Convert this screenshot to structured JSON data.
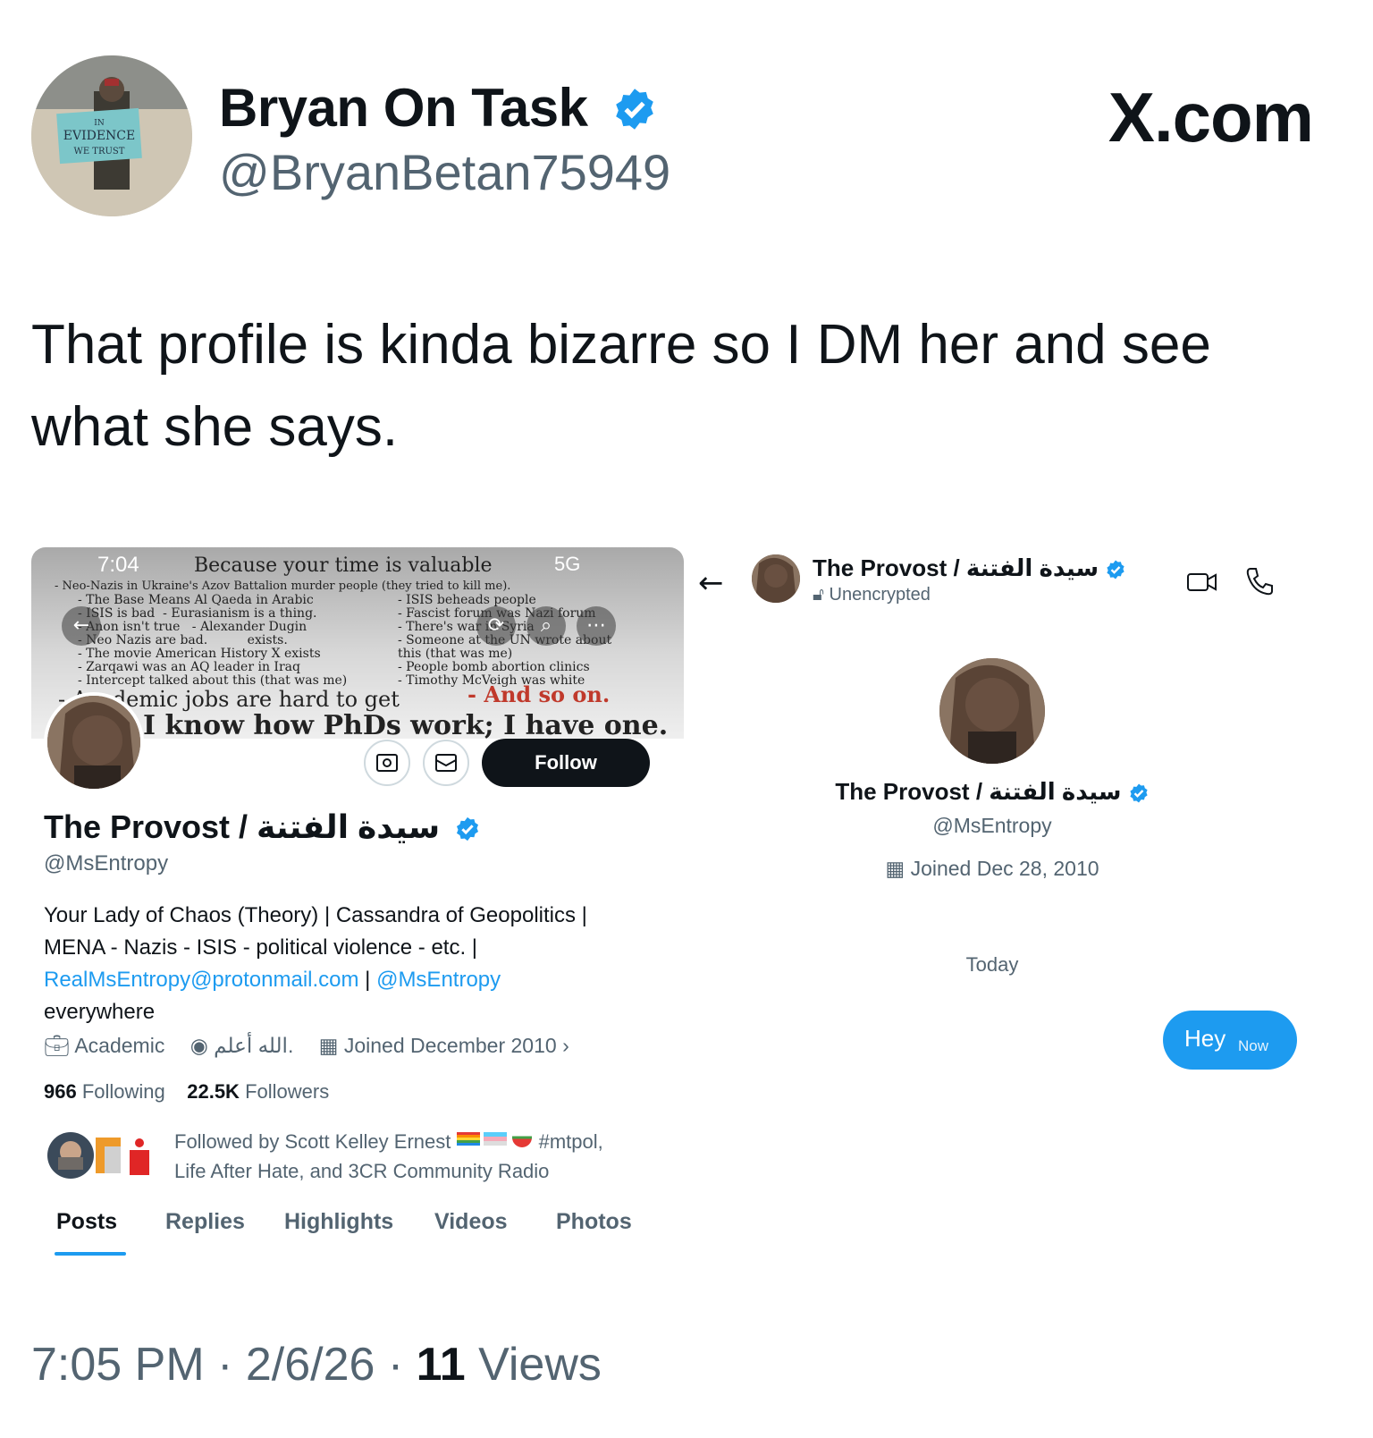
{
  "tweet": {
    "author_name": "Bryan On Task",
    "author_handle": "@BryanBetan75949",
    "brand": "X.com",
    "avatar_sign": {
      "line1": "IN",
      "line2": "EVIDENCE",
      "line3": "WE TRUST"
    },
    "text": "That profile is kinda bizarre so I DM her and see what she says.",
    "footer": {
      "time": "7:05 PM",
      "sep1": " · ",
      "date": "2/6/26",
      "sep2": " · ",
      "views_count": "11",
      "views_label": " Views"
    }
  },
  "profile_screenshot": {
    "status_time": "7:04",
    "status_network": "5G",
    "banner": {
      "line1": "Because your time is valuable",
      "line2": "- Neo-Nazis in Ukraine's Azov Battalion murder people (they tried to kill me).",
      "col1": "- The Base Means Al Qaeda in Arabic\n- ISIS is bad  - Eurasianism is a thing.\n- Anon isn't true   - Alexander Dugin\n- Neo Nazis are bad.          exists.\n- The movie American History X exists\n- Zarqawi was an AQ leader in Iraq\n- Intercept talked about this (that was me)",
      "col2": "- ISIS beheads people\n- Fascist forum was Nazi forum\n- There's war in Syria\n- Someone at the UN wrote about\nthis (that was me)\n- People bomb abortion clinics\n- Timothy McVeigh was white",
      "academic": "- Academic jobs are hard to get",
      "so_on": "- And so on.",
      "phd": "I know how PhDs work; I have one."
    },
    "follow_label": "Follow",
    "name": "The Provost / سيدة الفتنة",
    "handle": "@MsEntropy",
    "bio_line1": "Your Lady of Chaos (Theory) | Cassandra of Geopolitics |",
    "bio_line2": "MENA - Nazis - ISIS - political violence - etc. |",
    "bio_email": "RealMsEntropy@protonmail.com",
    "bio_sep": " | ",
    "bio_mention": "@MsEntropy",
    "bio_line4": "everywhere",
    "meta": {
      "category": "Academic",
      "location": "الله أعلم.",
      "joined": "Joined December 2010"
    },
    "following_count": "966",
    "following_label": "Following",
    "followers_count": "22.5K",
    "followers_label": "Followers",
    "followed_by_line1": "Followed by Scott Kelley Ernest",
    "followed_by_tag": "#mtpol,",
    "followed_by_line2": "Life After Hate, and 3CR Community Radio",
    "tabs": [
      "Posts",
      "Replies",
      "Highlights",
      "Videos",
      "Photos"
    ],
    "active_tab": "Posts"
  },
  "dm_screenshot": {
    "name": "The Provost / سيدة الفتنة",
    "encryption": "Unencrypted",
    "big_name": "The Provost / سيدة الفتنة",
    "handle": "@MsEntropy",
    "joined": "Joined Dec 28, 2010",
    "day_label": "Today",
    "message": "Hey",
    "message_time": "Now"
  },
  "colors": {
    "accent": "#1d9bf0",
    "text": "#0f1419",
    "muted": "#536471"
  }
}
